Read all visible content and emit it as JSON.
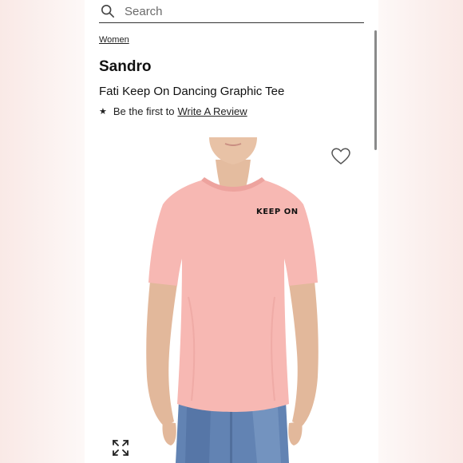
{
  "search": {
    "placeholder": "Search"
  },
  "breadcrumb": "Women",
  "product": {
    "brand": "Sandro",
    "name": "Fati Keep On Dancing Graphic Tee",
    "review_prompt": "Be the first to",
    "review_link": "Write A Review",
    "shirt_print": "KEEP ON"
  },
  "icons": {
    "search": "search-icon",
    "star": "star-icon",
    "wishlist": "heart-icon",
    "zoom": "expand-icon"
  },
  "colors": {
    "shirt": "#f7b8b3",
    "jeans": "#5d7fb0",
    "skin": "#e2b89b"
  }
}
